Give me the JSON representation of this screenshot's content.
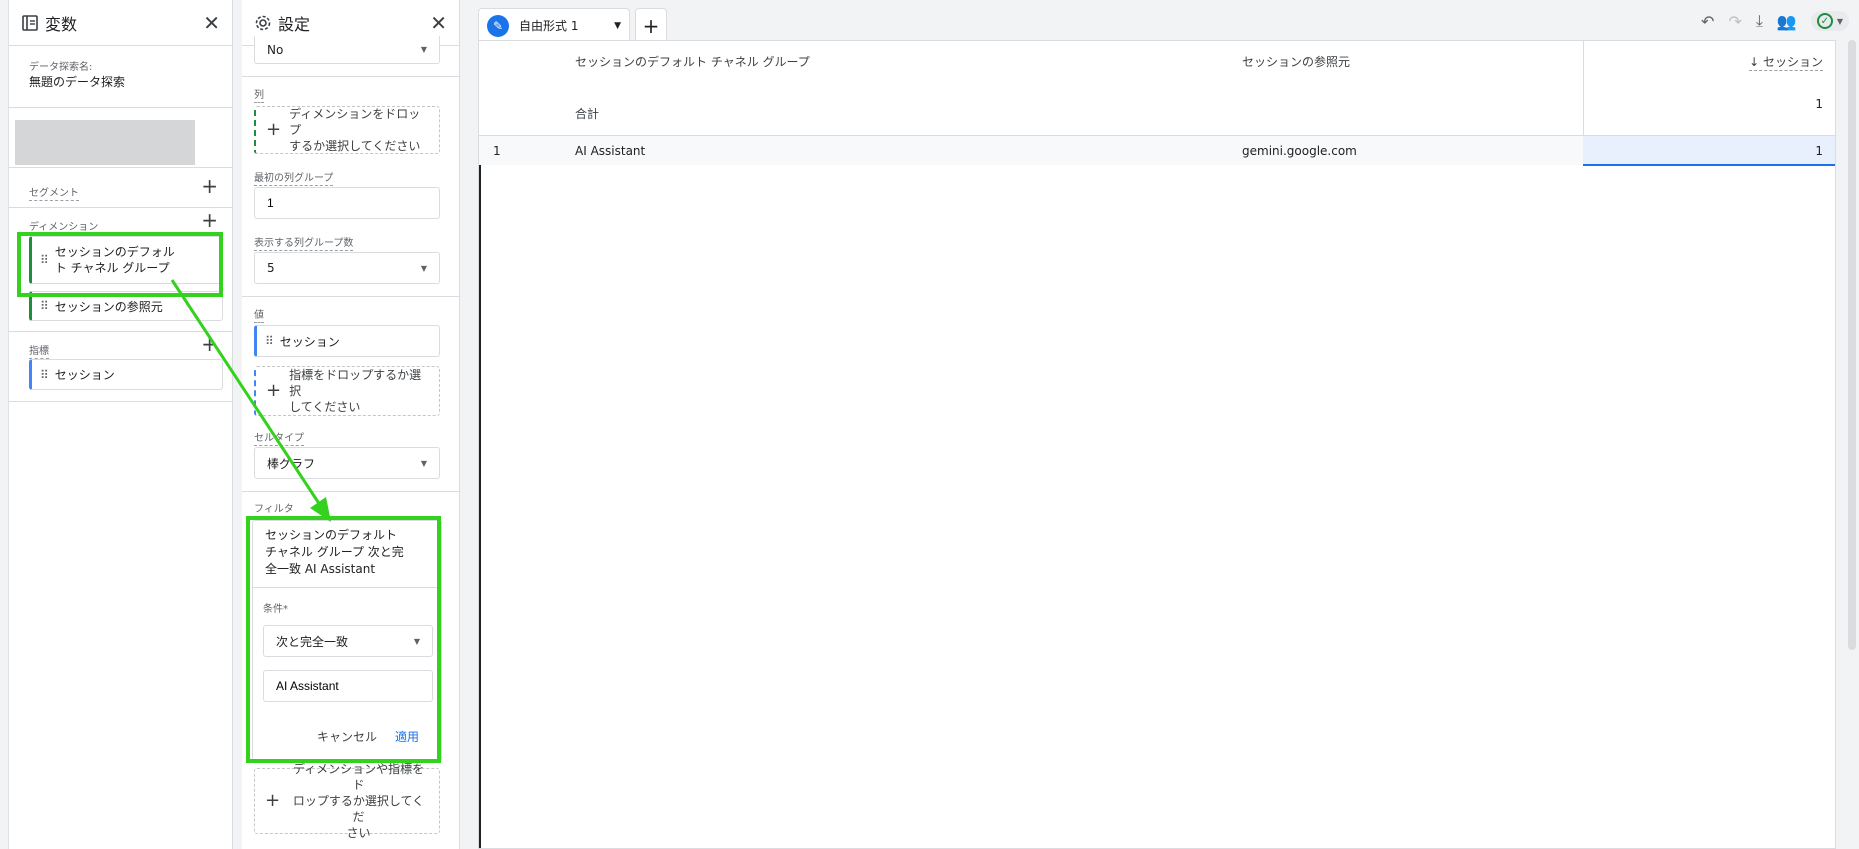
{
  "variables": {
    "title": "変数",
    "exploration_name_label": "データ探索名:",
    "exploration_name": "無題のデータ探索",
    "segment_label": "セグメント",
    "dimension_label": "ディメンション",
    "dimensions": [
      "セッションのデフォルト チャネル グループ",
      "セッションの参照元"
    ],
    "dimension_line1": "セッションのデフォル",
    "dimension_line2": "ト チャネル グループ",
    "metric_label": "指標",
    "metrics": [
      "セッション"
    ]
  },
  "settings": {
    "title": "設定",
    "top_select": "No",
    "columns_label": "列",
    "columns_dropzone_line1": "ディメンションをドロップ",
    "columns_dropzone_line2": "するか選択してください",
    "first_group_label": "最初の列グループ",
    "first_group_value": "1",
    "groups_count_label": "表示する列グループ数",
    "groups_count_value": "5",
    "values_label": "値",
    "value_item": "セッション",
    "values_dropzone_line1": "指標をドロップするか選択",
    "values_dropzone_line2": "してください",
    "cell_type_label": "セルタイプ",
    "cell_type_value": "棒グラフ",
    "filter_label": "フィルタ",
    "filter_summary_line1": "セッションのデフォルト",
    "filter_summary_line2": "チャネル グループ 次と完",
    "filter_summary_line3": "全一致 AI Assistant",
    "condition_label": "条件*",
    "condition_value": "次と完全一致",
    "match_value": "AI Assistant",
    "cancel_label": "キャンセル",
    "apply_label": "適用",
    "bottom_dropzone_line1": "ディメンションや指標をド",
    "bottom_dropzone_line2": "ロップするか選択してくだ",
    "bottom_dropzone_line3": "さい"
  },
  "tabs": {
    "active_label": "自由形式 1"
  },
  "table": {
    "col_dim1": "セッションのデフォルト チャネル グループ",
    "col_dim2": "セッションの参照元",
    "col_metric": "セッション",
    "total_label": "合計",
    "total_value": "1",
    "rows": [
      {
        "index": "1",
        "channel": "AI Assistant",
        "source": "gemini.google.com",
        "sessions": "1"
      }
    ]
  },
  "colors": {
    "highlight": "#34d11e",
    "accent": "#1a73e8",
    "dimension": "#1e8e3e",
    "metric": "#4285f4"
  }
}
